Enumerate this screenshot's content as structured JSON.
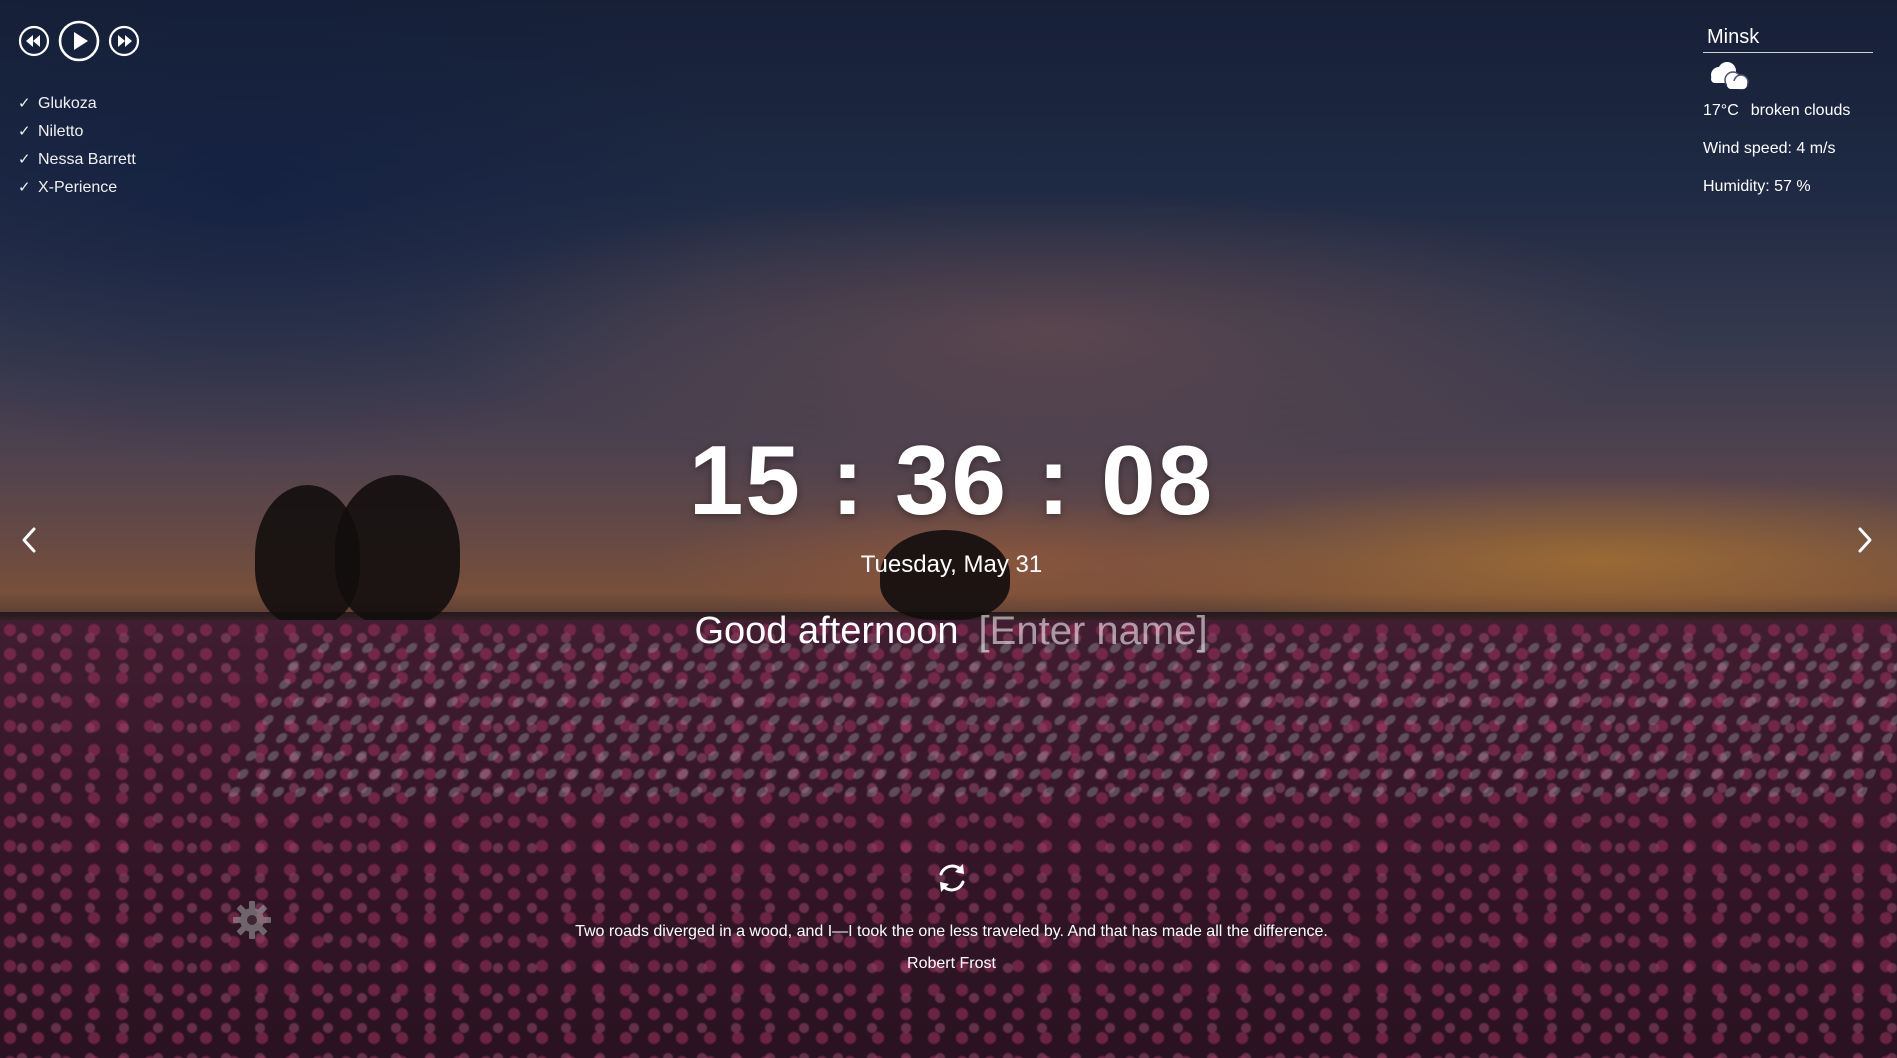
{
  "player": {
    "prev_icon": "rewind-icon",
    "play_icon": "play-icon",
    "next_icon": "fast-forward-icon",
    "playlist": [
      {
        "title": "Glukoza"
      },
      {
        "title": "Niletto"
      },
      {
        "title": "Nessa Barrett"
      },
      {
        "title": "X-Perience"
      }
    ],
    "check_glyph": "✓"
  },
  "weather": {
    "city": "Minsk",
    "icon": "broken-clouds-icon",
    "temperature": "17°C",
    "description": "broken clouds",
    "wind": "Wind speed: 4 m/s",
    "humidity": "Humidity: 57 %"
  },
  "clock": {
    "time": "15 : 36 : 08",
    "date": "Tuesday, May 31"
  },
  "greeting": {
    "text": "Good afternoon",
    "name_placeholder": "[Enter name]"
  },
  "quote": {
    "text": "Two roads diverged in a wood, and I—I took the one less traveled by. And that has made all the difference.",
    "author": "Robert Frost"
  },
  "icons": {
    "slider_prev": "chevron-left-icon",
    "slider_next": "chevron-right-icon",
    "refresh": "refresh-icon",
    "settings": "gear-icon"
  },
  "colors": {
    "text": "#ffffff"
  }
}
